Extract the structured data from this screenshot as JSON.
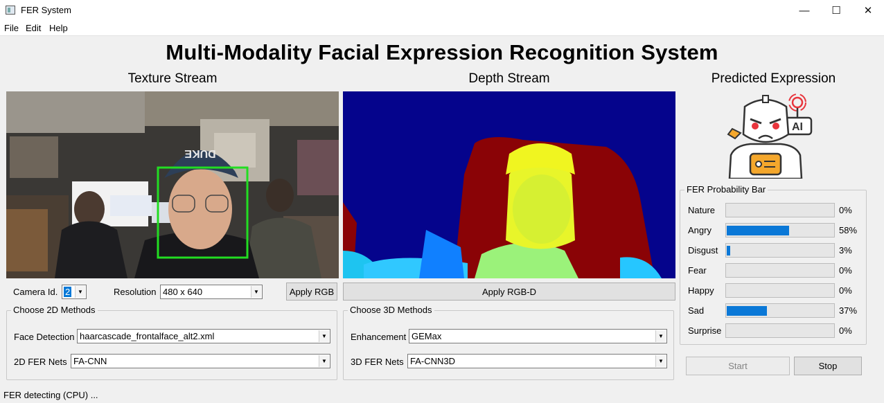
{
  "window": {
    "title": "FER System"
  },
  "window_controls": {
    "minimize": "—",
    "maximize": "☐",
    "close": "✕"
  },
  "menu": [
    "File",
    "Edit",
    "Help"
  ],
  "main_title": "Multi-Modality Facial Expression Recognition System",
  "texture": {
    "title": "Texture Stream",
    "camera_label": "Camera Id.",
    "camera_value": "2",
    "resolution_label": "Resolution",
    "resolution_value": "480 x 640",
    "apply_button": "Apply RGB",
    "logo_text": "DUKE"
  },
  "depth": {
    "title": "Depth Stream",
    "apply_button": "Apply RGB-D"
  },
  "methods2d": {
    "title": "Choose 2D Methods",
    "face_detection_label": "Face Detection",
    "face_detection_value": "haarcascade_frontalface_alt2.xml",
    "fer_net_label": "2D FER Nets",
    "fer_net_value": "FA-CNN"
  },
  "methods3d": {
    "title": "Choose 3D Methods",
    "enhancement_label": "Enhancement",
    "enhancement_value": "GEMax",
    "fer_net_label": "3D FER Nets",
    "fer_net_value": "FA-CNN3D"
  },
  "prediction": {
    "title": "Predicted Expression",
    "icon": "angry-robot-icon",
    "icon_badge": "AI",
    "accent_red": "#e8343c",
    "accent_orange": "#f4a72c"
  },
  "probability": {
    "title": "FER Probability Bar",
    "bar_color": "#0a78d7",
    "rows": [
      {
        "label": "Nature",
        "value": 0,
        "pct": "0%"
      },
      {
        "label": "Angry",
        "value": 0.58,
        "pct": "58%"
      },
      {
        "label": "Disgust",
        "value": 0.03,
        "pct": "3%"
      },
      {
        "label": "Fear",
        "value": 0,
        "pct": "0%"
      },
      {
        "label": "Happy",
        "value": 0,
        "pct": "0%"
      },
      {
        "label": "Sad",
        "value": 0.37,
        "pct": "37%"
      },
      {
        "label": "Surprise",
        "value": 0,
        "pct": "0%"
      }
    ]
  },
  "controls": {
    "start": "Start",
    "stop": "Stop"
  },
  "status": "FER detecting (CPU) ...",
  "detection_box_color": "#22dd22"
}
